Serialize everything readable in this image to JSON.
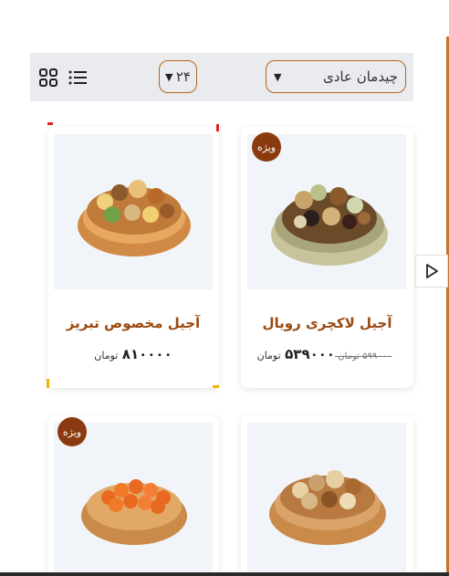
{
  "toolbar": {
    "sort_value": "چیدمان عادی",
    "per_page_value": "۲۴",
    "grid_view_icon": "grid-icon",
    "list_view_icon": "list-icon"
  },
  "products": [
    {
      "title": "آجیل لاکچری رویال",
      "price": "۵۳۹۰۰۰",
      "old_price": "۵۹۹۰۰۰",
      "currency": "تومان",
      "old_currency": "تومان",
      "badge": "ویژه"
    },
    {
      "title": "آجیل مخصوص تبریز",
      "price": "۸۱۰۰۰۰",
      "currency": "تومان"
    },
    {
      "badge": ""
    },
    {
      "badge": "ویژه"
    }
  ],
  "colors": {
    "accent": "#b5651d",
    "badge": "#8b3a0f",
    "title": "#9a4a12"
  },
  "side_arrow_icon": "play-triangle-icon"
}
